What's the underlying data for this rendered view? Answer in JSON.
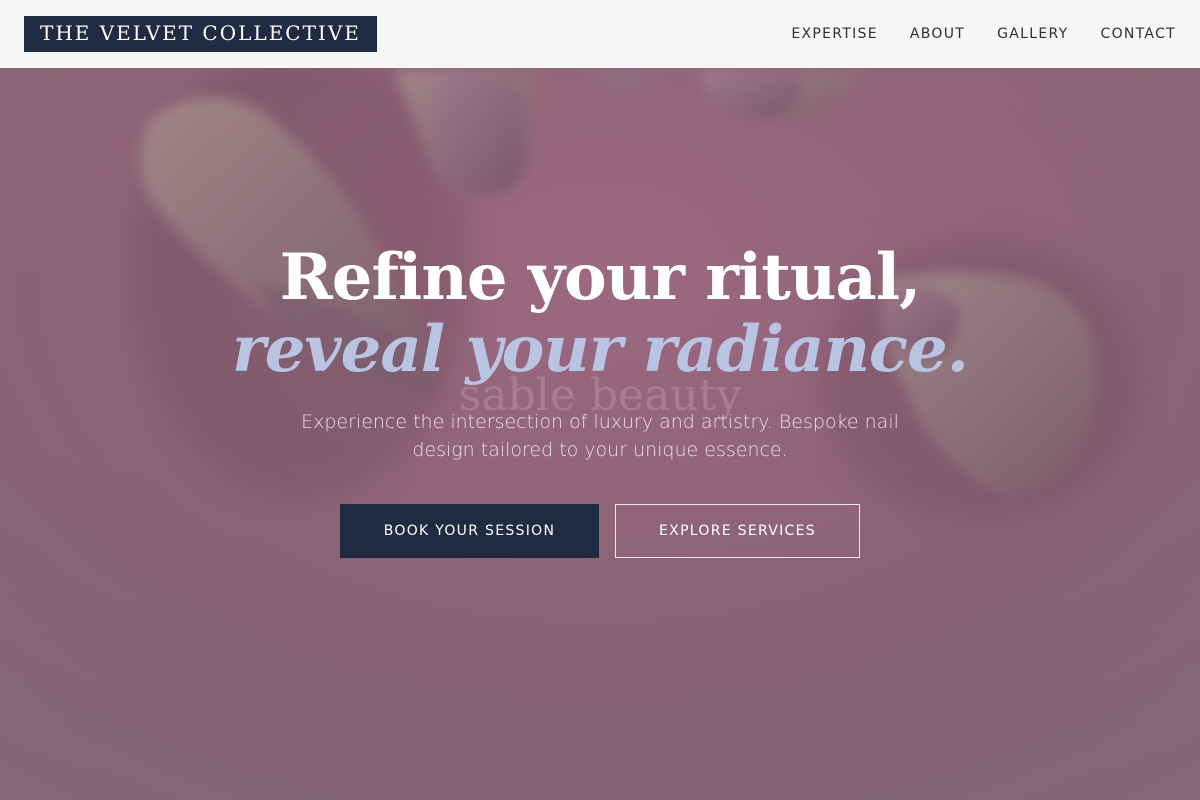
{
  "brand": {
    "logo_text": "THE VELVET COLLECTIVE"
  },
  "nav": {
    "items": [
      {
        "label": "EXPERTISE"
      },
      {
        "label": "ABOUT"
      },
      {
        "label": "GALLERY"
      },
      {
        "label": "CONTACT"
      }
    ]
  },
  "hero": {
    "headline_line1": "Refine your ritual,",
    "headline_line2": "reveal your radiance.",
    "background_text": "sable beauty",
    "subheadline": "Experience the intersection of luxury and artistry. Bespoke nail design tailored to your unique essence.",
    "primary_cta": "BOOK YOUR SESSION",
    "secondary_cta": "EXPLORE SERVICES"
  },
  "colors": {
    "navy": "#1f2b40",
    "accent_periwinkle": "#b8c4e2",
    "hero_pink": "#8a6674",
    "header_bg": "#f7f6f7"
  }
}
